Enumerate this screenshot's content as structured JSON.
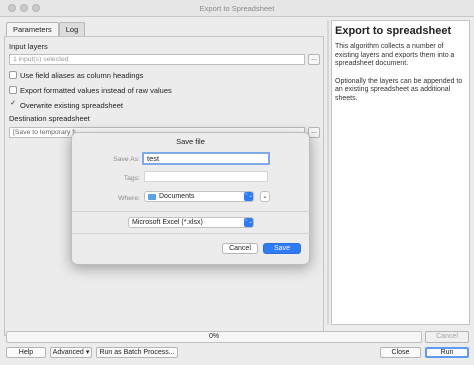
{
  "window": {
    "title": "Export to Spreadsheet"
  },
  "tabs": [
    {
      "label": "Parameters"
    },
    {
      "label": "Log"
    }
  ],
  "params": {
    "input_layers_label": "Input layers",
    "input_layers_value": "1 input(s) selected",
    "browse_label": "...",
    "checkboxes": [
      {
        "label": "Use field aliases as column headings",
        "checked": false
      },
      {
        "label": "Export formatted values instead of raw values",
        "checked": false
      },
      {
        "label": "Overwrite existing spreadsheet",
        "checked": true
      }
    ],
    "destination_label": "Destination spreadsheet",
    "destination_value": "[Save to temporary fi",
    "checkmark": "✓"
  },
  "help": {
    "title": "Export to spreadsheet",
    "paragraph1": "This algorithm collects a number of existing layers and exports them into a spreadsheet document.",
    "paragraph2": "Optionally the layers can be appended to an existing spreadsheet as additional sheets."
  },
  "save_dialog": {
    "title": "Save file",
    "save_as_label": "Save As:",
    "save_as_value": "test",
    "tags_label": "Tags:",
    "where_label": "Where:",
    "where_value": "Documents",
    "format_value": "Microsoft Excel (*.xlsx)",
    "cancel_label": "Cancel",
    "save_label": "Save",
    "stepper_glyph": "⌃⌄",
    "expand_glyph": "⌄"
  },
  "progress": {
    "text": "0%",
    "value": 0
  },
  "buttons": {
    "cancel": "Cancel",
    "help": "Help",
    "advanced": "Advanced",
    "advanced_arrow": "▾",
    "batch": "Run as Batch Process...",
    "close": "Close",
    "run": "Run"
  },
  "colors": {
    "accent": "#2f7bf5",
    "focus_ring": "#7fa9e8"
  }
}
